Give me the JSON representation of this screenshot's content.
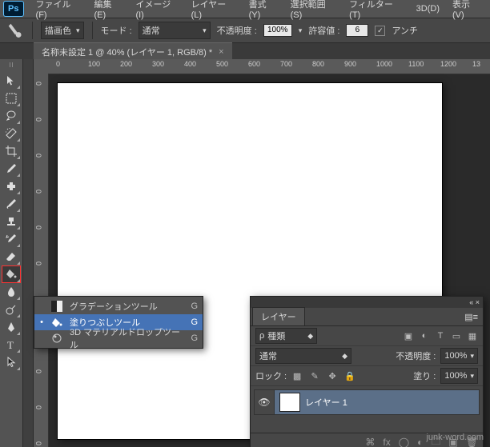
{
  "app": {
    "logo": "Ps"
  },
  "menu": [
    "ファイル(F)",
    "編集(E)",
    "イメージ(I)",
    "レイヤー(L)",
    "書式(Y)",
    "選択範囲(S)",
    "フィルター(T)",
    "3D(D)",
    "表示(V)"
  ],
  "optbar": {
    "foreground": "描画色",
    "mode_lbl": "モード :",
    "mode_val": "通常",
    "opacity_lbl": "不透明度 :",
    "opacity_val": "100%",
    "tolerance_lbl": "許容値 :",
    "tolerance_val": "6",
    "anti_lbl": "アンチ",
    "anti_chk": "✓"
  },
  "tab": {
    "title": "名称未設定 1 @ 40% (レイヤー 1, RGB/8) *",
    "close": "×"
  },
  "ruler_h": [
    "0",
    "100",
    "200",
    "300",
    "400",
    "500",
    "600",
    "700",
    "800",
    "900",
    "1000",
    "1100",
    "1200",
    "13"
  ],
  "ruler_v": [
    "0",
    "0",
    "0",
    "0",
    "0",
    "0",
    "0",
    "0",
    "0",
    "0",
    "0"
  ],
  "flyout": [
    {
      "mark": "",
      "icon": "grad",
      "label": "グラデーションツール",
      "key": "G"
    },
    {
      "mark": "•",
      "icon": "bucket",
      "label": "塗りつぶしツール",
      "key": "G"
    },
    {
      "mark": "",
      "icon": "3d",
      "label": "3D マテリアルドロップツール",
      "key": "G"
    }
  ],
  "panel": {
    "tab": "レイヤー",
    "kind": "種類",
    "blend": "通常",
    "opacity_lbl": "不透明度 :",
    "opacity_val": "100%",
    "lock_lbl": "ロック :",
    "fill_lbl": "塗り :",
    "fill_val": "100%",
    "layer_name": "レイヤー 1",
    "collapse": "« ×",
    "menu": "▤≡"
  },
  "chart_data": null,
  "watermark": "junk-word.com"
}
